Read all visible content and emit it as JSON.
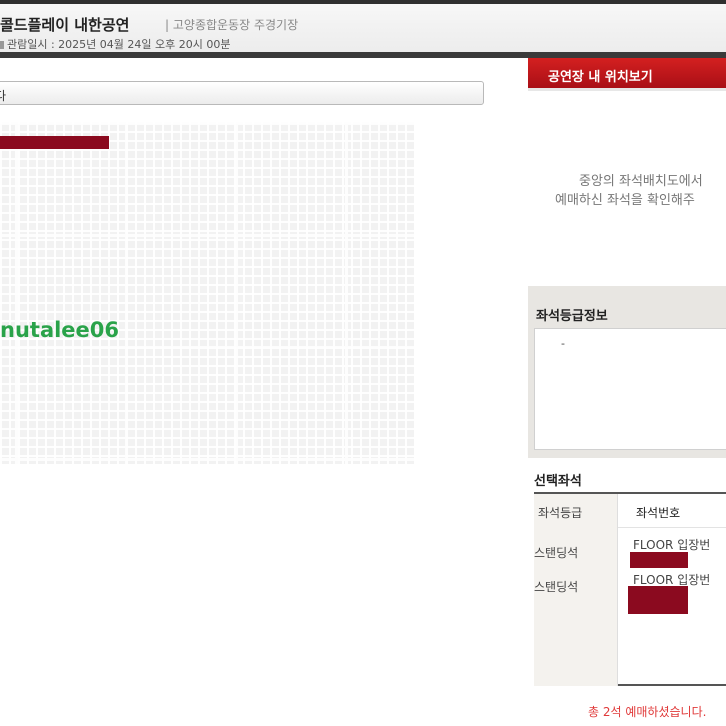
{
  "header": {
    "title": "콜드플레이 내한공연",
    "venue": "| 고양종합운동장 주경기장",
    "datetime_label": "관람일시 : 2025년 04월 24일 오후 20시 00분"
  },
  "seat_selector": {
    "value": "다"
  },
  "seat_map": {
    "watermark": "nutalee06",
    "selected_color": "#8b0a1f"
  },
  "right_panel": {
    "location_button": "공연장 내 위치보기",
    "info_line1": "중앙의 좌석배치도에서",
    "info_line2": "예매하신 좌석을 확인해주",
    "grade_info_title": "좌석등급정보",
    "grade_info_value": "-",
    "selected_title": "선택좌석",
    "table_headers": [
      "좌석등급",
      "좌석번호"
    ],
    "rows": [
      {
        "grade": "스탠딩석",
        "seat": "FLOOR  입장번"
      },
      {
        "grade": "스탠딩석",
        "seat": "FLOOR  입장번"
      }
    ],
    "total": "총 2석  예매하셨습니다."
  },
  "colors": {
    "accent_red": "#c41a1f",
    "redaction": "#8b0a1f",
    "watermark_green": "#2aa34a"
  }
}
